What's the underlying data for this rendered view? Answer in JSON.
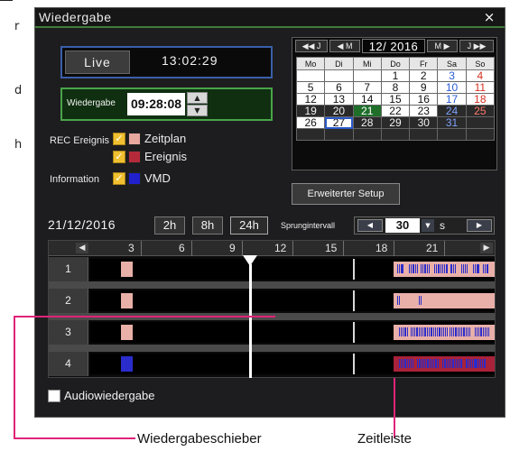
{
  "window": {
    "title": "Wiedergabe",
    "close_glyph": "×"
  },
  "side_glyphs": [
    "r",
    "d",
    "h"
  ],
  "live": {
    "label": "Live",
    "time": "13:02:29"
  },
  "playback": {
    "label": "Wiedergabe",
    "time": "09:28:08",
    "spin_up": "▲",
    "spin_down": "▼"
  },
  "rec": {
    "label": "REC Ereignis",
    "items": [
      {
        "label": "Zeitplan",
        "color": "#e8a8a0",
        "checked": true
      },
      {
        "label": "Ereignis",
        "color": "#b52a3a",
        "checked": true
      }
    ]
  },
  "information": {
    "label": "Information",
    "items": [
      {
        "label": "VMD",
        "color": "#2020cc",
        "checked": true
      }
    ]
  },
  "calendar": {
    "nav": {
      "prev_year": "◀◀ J",
      "prev_month": "◀ M",
      "month_year": "12/ 2016",
      "next_month": "M ▶",
      "next_year": "J ▶▶"
    },
    "weekdays": [
      "Mo",
      "Di",
      "Mi",
      "Do",
      "Fr",
      "Sa",
      "So"
    ],
    "rows": [
      [
        {
          "d": ""
        },
        {
          "d": ""
        },
        {
          "d": ""
        },
        {
          "d": "1"
        },
        {
          "d": "2"
        },
        {
          "d": "3",
          "c": "sat"
        },
        {
          "d": "4",
          "c": "sun"
        }
      ],
      [
        {
          "d": "5"
        },
        {
          "d": "6"
        },
        {
          "d": "7"
        },
        {
          "d": "8"
        },
        {
          "d": "9"
        },
        {
          "d": "10",
          "c": "sat"
        },
        {
          "d": "11",
          "c": "sun"
        }
      ],
      [
        {
          "d": "12"
        },
        {
          "d": "13"
        },
        {
          "d": "14"
        },
        {
          "d": "15"
        },
        {
          "d": "16"
        },
        {
          "d": "17",
          "c": "sat"
        },
        {
          "d": "18",
          "c": "sun"
        }
      ],
      [
        {
          "d": "19",
          "c": "dark"
        },
        {
          "d": "20",
          "c": "dark"
        },
        {
          "d": "21",
          "c": "green"
        },
        {
          "d": "22"
        },
        {
          "d": "23"
        },
        {
          "d": "24",
          "c": "dark sat"
        },
        {
          "d": "25",
          "c": "dark sun"
        }
      ],
      [
        {
          "d": "26"
        },
        {
          "d": "27",
          "c": "sel"
        },
        {
          "d": "28",
          "c": "dark"
        },
        {
          "d": "29",
          "c": "dark"
        },
        {
          "d": "30",
          "c": "dark"
        },
        {
          "d": "31",
          "c": "dark sat"
        },
        {
          "d": "",
          "c": "dark"
        }
      ],
      [
        {
          "d": "",
          "c": "dark"
        },
        {
          "d": "",
          "c": "dark"
        },
        {
          "d": "",
          "c": "dark"
        },
        {
          "d": "",
          "c": "dark"
        },
        {
          "d": "",
          "c": "dark"
        },
        {
          "d": "",
          "c": "dark"
        },
        {
          "d": "",
          "c": "dark"
        }
      ]
    ]
  },
  "setup_button": "Erweiterter Setup",
  "datebar": {
    "date": "21/12/2016",
    "ranges": [
      "2h",
      "8h",
      "24h"
    ],
    "active_range": "24h",
    "jump_label": "Sprungintervall",
    "jump_value": "30",
    "jump_unit": "s",
    "jump_left": "◀",
    "jump_right": "▶",
    "jump_dropdown": "▼"
  },
  "timeline": {
    "scroll_left": "◀",
    "scroll_right": "▶",
    "hour_labels": [
      "3",
      "6",
      "9",
      "12",
      "15",
      "18",
      "21"
    ],
    "rows": [
      "1",
      "2",
      "3",
      "4"
    ],
    "slider_hour": 9.47
  },
  "audio": {
    "label": "Audiowiedergabe",
    "checked": false
  },
  "callouts": {
    "slider_caption": "Wiedergabeschieber",
    "timeline_caption": "Zeitleiste",
    "line_color": "#e0237a"
  },
  "colors": {
    "schedule": "#e8b0a8",
    "event": "#a8223a",
    "vmd": "#2a2ccc",
    "playback_green": "#49a449",
    "live_blue": "#3a5faa"
  }
}
